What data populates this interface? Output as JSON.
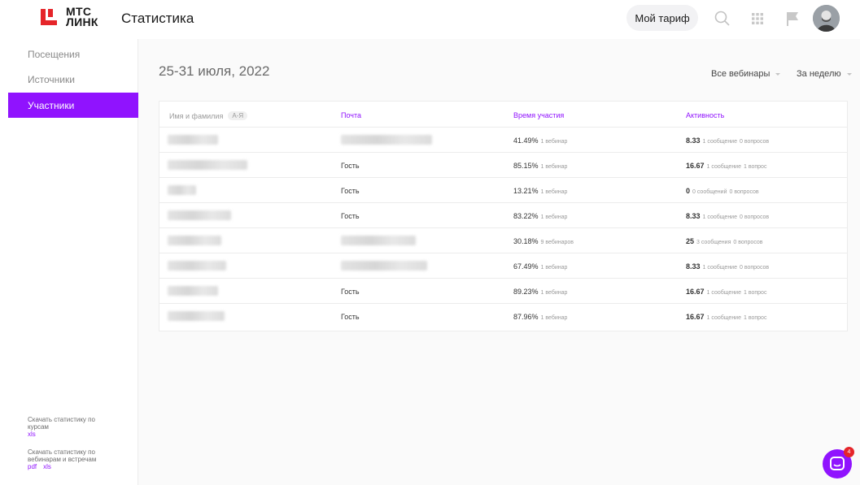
{
  "header": {
    "logo_line1": "МТС",
    "logo_line2": "ЛИНК",
    "title": "Статистика",
    "tariff_label": "Мой тариф"
  },
  "sidebar": {
    "items": [
      {
        "label": "Посещения",
        "active": false
      },
      {
        "label": "Источники",
        "active": false
      },
      {
        "label": "Участники",
        "active": true
      }
    ],
    "downloads": [
      {
        "text": "Скачать статистику по курсам",
        "links": [
          "xls"
        ]
      },
      {
        "text": "Скачать статистику по вебинарам и встречам",
        "links": [
          "pdf",
          "xls"
        ]
      }
    ]
  },
  "main": {
    "date_range": "25-31 июля, 2022",
    "filters": [
      "Все вебинары",
      "За неделю"
    ],
    "table": {
      "headers": {
        "name": "Имя и фамилия",
        "sort": "А-Я",
        "mail": "Почта",
        "time": "Время участия",
        "activity": "Активность"
      },
      "rows": [
        {
          "mail": "",
          "time": "41.49%",
          "webinars": "1 вебинар",
          "score": "8.33",
          "messages": "1 сообщение",
          "questions": "0 вопросов"
        },
        {
          "mail": "Гость",
          "time": "85.15%",
          "webinars": "1 вебинар",
          "score": "16.67",
          "messages": "1 сообщение",
          "questions": "1 вопрос"
        },
        {
          "mail": "Гость",
          "time": "13.21%",
          "webinars": "1 вебинар",
          "score": "0",
          "messages": "0 сообщений",
          "questions": "0 вопросов"
        },
        {
          "mail": "Гость",
          "time": "83.22%",
          "webinars": "1 вебинар",
          "score": "8.33",
          "messages": "1 сообщение",
          "questions": "0 вопросов"
        },
        {
          "mail": "",
          "time": "30.18%",
          "webinars": "9 вебинаров",
          "score": "25",
          "messages": "3 сообщения",
          "questions": "0 вопросов"
        },
        {
          "mail": "",
          "time": "67.49%",
          "webinars": "1 вебинар",
          "score": "8.33",
          "messages": "1 сообщение",
          "questions": "0 вопросов"
        },
        {
          "mail": "Гость",
          "time": "89.23%",
          "webinars": "1 вебинар",
          "score": "16.67",
          "messages": "1 сообщение",
          "questions": "1 вопрос"
        },
        {
          "mail": "Гость",
          "time": "87.96%",
          "webinars": "1 вебинар",
          "score": "16.67",
          "messages": "1 сообщение",
          "questions": "1 вопрос"
        }
      ]
    }
  },
  "chat": {
    "badge": "4"
  },
  "colors": {
    "accent": "#9013fe",
    "brand_red": "#e5252a"
  }
}
